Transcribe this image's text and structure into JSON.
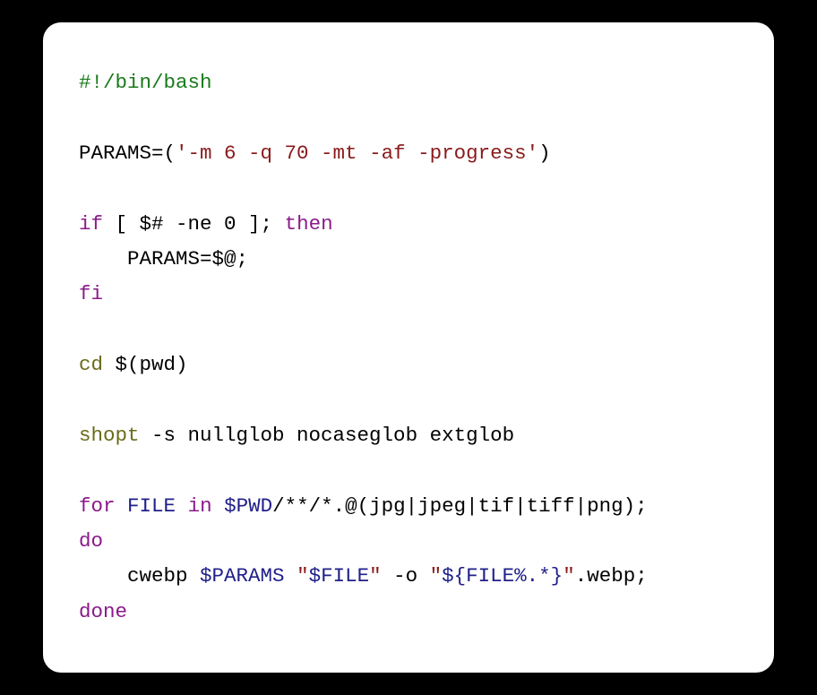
{
  "code": {
    "line1_shebang": "#!/bin/bash",
    "line3_var": "PARAMS",
    "line3_eq": "=(",
    "line3_str": "'-m 6 -q 70 -mt -af -progress'",
    "line3_close": ")",
    "line5_if": "if",
    "line5_cond": " [ $# -ne 0 ]; ",
    "line5_then": "then",
    "line6_indent": "    ",
    "line6_lhs": "PARAMS=",
    "line6_rhs": "$@;",
    "line7_fi": "fi",
    "line9_cd": "cd",
    "line9_arg": " $(pwd)",
    "line11_shopt": "shopt",
    "line11_args": " -s nullglob nocaseglob extglob",
    "line13_for": "for",
    "line13_sp1": " ",
    "line13_var": "FILE",
    "line13_sp2": " ",
    "line13_in": "in",
    "line13_sp3": " ",
    "line13_pwd": "$PWD",
    "line13_rest": "/**/*.@(jpg|jpeg|tif|tiff|png);",
    "line14_do": "do",
    "line15_indent": "    cwebp ",
    "line15_params": "$PARAMS",
    "line15_sp1": " ",
    "line15_q1": "\"",
    "line15_file": "$FILE",
    "line15_q2": "\"",
    "line15_o": " -o ",
    "line15_q3": "\"",
    "line15_exp_open": "${",
    "line15_exp_var": "FILE",
    "line15_exp_op": "%.*}",
    "line15_q4": "\"",
    "line15_ext": ".webp;",
    "line16_done": "done"
  }
}
